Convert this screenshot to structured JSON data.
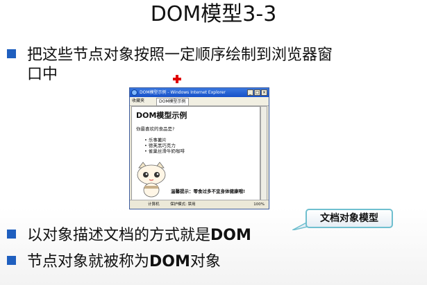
{
  "slide": {
    "title": "DOM模型3-3",
    "bullet1_line1": "把这些节点对象按照一定顺序绘制到浏览器窗",
    "bullet1_line2": "口中",
    "bullet2_pre": "以对象描述文档的方式就是",
    "bullet2_bold": "DOM",
    "bullet3_pre": "节点对象就被称为",
    "bullet3_bold": "DOM",
    "bullet3_post": "对象",
    "callout": "文档对象模型"
  },
  "browser": {
    "window_title": "DOM模型示例 - Windows Internet Explorer",
    "favorites": "收藏夹",
    "tab": "DOM模型示例",
    "heading": "DOM模型示例",
    "question": "你最喜欢的食品是?",
    "foods": [
      "乐事薯片",
      "德芙黑巧克力",
      "雀巢丝滑牛奶咖啡"
    ],
    "tip": "温馨提示：零食过多不宜身体健康哦!",
    "status_computer": "计算机",
    "status_mode": "保护模式: 禁用",
    "zoom": "100%"
  },
  "colors": {
    "bullet": "#1f5fbf",
    "callout_border": "#6fbfcf",
    "cross": "#e00000"
  }
}
